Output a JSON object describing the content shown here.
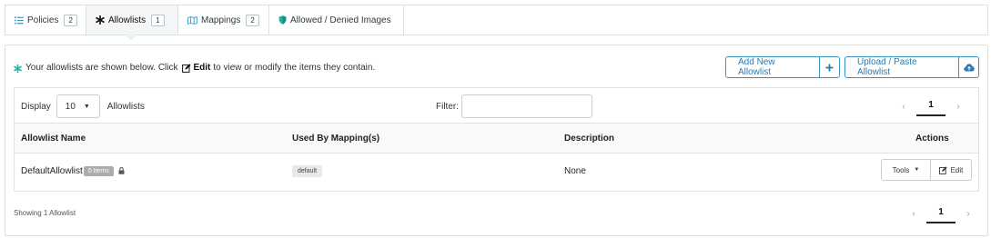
{
  "tabs": [
    {
      "label": "Policies",
      "count": "2",
      "icon": "list-icon",
      "active": false
    },
    {
      "label": "Allowlists",
      "count": "1",
      "icon": "asterisk-icon",
      "active": true
    },
    {
      "label": "Mappings",
      "count": "2",
      "icon": "map-icon",
      "active": false
    },
    {
      "label": "Allowed / Denied Images",
      "icon": "shield-icon",
      "active": false
    }
  ],
  "info": {
    "prefix": "Your allowlists are shown below. Click",
    "edit_word": "Edit",
    "suffix": "to view or modify the items they contain."
  },
  "buttons": {
    "add_label": "Add New Allowlist",
    "upload_label": "Upload / Paste Allowlist"
  },
  "controls": {
    "display_label": "Display",
    "page_size": "10",
    "page_size_suffix": "Allowlists",
    "filter_label": "Filter:",
    "filter_value": "",
    "current_page": "1"
  },
  "table": {
    "columns": [
      "Allowlist Name",
      "Used By Mapping(s)",
      "Description",
      "Actions"
    ],
    "rows": [
      {
        "name": "DefaultAllowlist",
        "items_badge": "0 Items",
        "mapping": "default",
        "description": "None",
        "tools_label": "Tools",
        "edit_label": "Edit"
      }
    ]
  },
  "footer": {
    "showing": "Showing 1 Allowlist"
  },
  "colors": {
    "accent": "#1fb5a4",
    "button_blue": "#3a8fc4",
    "border": "#d6e2e4"
  }
}
